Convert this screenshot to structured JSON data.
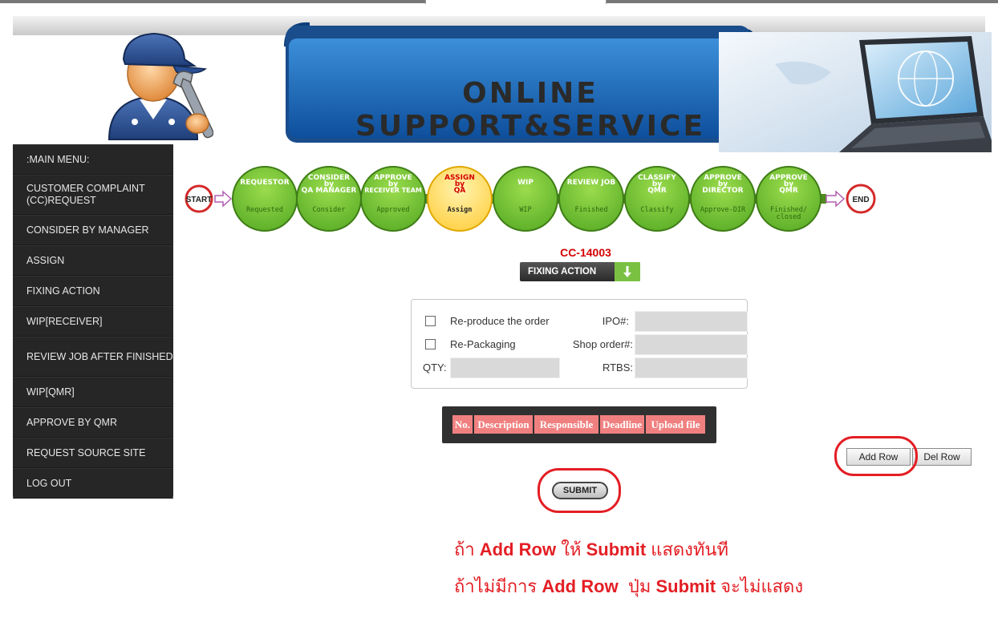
{
  "header": {
    "title": "ONLINE SUPPORT&SERVICE",
    "mascot_icon": "mechanic-mascot-icon",
    "laptop_icon": "laptop-globe-icon"
  },
  "sidebar": {
    "items": [
      {
        "label": ":MAIN MENU:"
      },
      {
        "label": "CUSTOMER COMPLAINT (CC)REQUEST"
      },
      {
        "label": "CONSIDER BY MANAGER"
      },
      {
        "label": "ASSIGN"
      },
      {
        "label": "FIXING ACTION"
      },
      {
        "label": "WIP[RECEIVER]"
      },
      {
        "label": "REVIEW JOB AFTER FINISHED"
      },
      {
        "label": "WIP[QMR]"
      },
      {
        "label": "APPROVE BY QMR"
      },
      {
        "label": "REQUEST SOURCE SITE"
      },
      {
        "label": "LOG OUT"
      }
    ]
  },
  "workflow": {
    "start": "START",
    "end": "END",
    "steps": [
      {
        "title": [
          "REQUESTOR"
        ],
        "status": "Requested",
        "active": false
      },
      {
        "title": [
          "CONSIDER",
          "by",
          "QA MANAGER"
        ],
        "status": "Consider",
        "active": false
      },
      {
        "title": [
          "APPROVE",
          "by",
          "RECEIVER TEAM"
        ],
        "status": "Approved",
        "active": false
      },
      {
        "title": [
          "ASSIGN",
          "by",
          "QA"
        ],
        "status": "Assign",
        "active": true
      },
      {
        "title": [
          "WIP"
        ],
        "status": "WIP",
        "active": false
      },
      {
        "title": [
          "REVIEW JOB"
        ],
        "status": "Finished",
        "active": false
      },
      {
        "title": [
          "CLASSIFY",
          "by",
          "QMR"
        ],
        "status": "Classify",
        "active": false
      },
      {
        "title": [
          "APPROVE",
          "by",
          "DIRECTOR"
        ],
        "status": "Approve-DIR",
        "active": false
      },
      {
        "title": [
          "APPROVE",
          "by",
          "QMR"
        ],
        "status": "Finished/ closed",
        "active": false
      }
    ],
    "colors": {
      "green": "#5fb12a",
      "green_light": "#9bdc4d",
      "yellow": "#ffd24a",
      "connector": "#4e8a1e",
      "end_red": "#d42a2a"
    }
  },
  "main": {
    "cc_number": "CC-14003",
    "fixing_action": "FIXING ACTION",
    "options": {
      "reproduce_label": "Re-produce the order",
      "repackaging_label": "Re-Packaging",
      "ipo_label": "IPO#:",
      "shop_order_label": "Shop order#:",
      "qty_label": "QTY:",
      "rtbs_label": "RTBS:"
    },
    "table": {
      "headers": [
        "No.",
        "Description",
        "Responsible",
        "Deadline",
        "Upload file"
      ]
    },
    "add_row": "Add Row",
    "del_row": "Del Row",
    "submit": "SUBMIT"
  },
  "notes": {
    "line1": [
      "ถ้า ",
      "Add Row",
      " ให้ ",
      "Submit",
      " แสดงทันที"
    ],
    "line2": [
      "ถ้าไม่มีการ ",
      "Add Row",
      "  ปุ่ม ",
      "Submit",
      " จะไม่แสดง"
    ]
  }
}
